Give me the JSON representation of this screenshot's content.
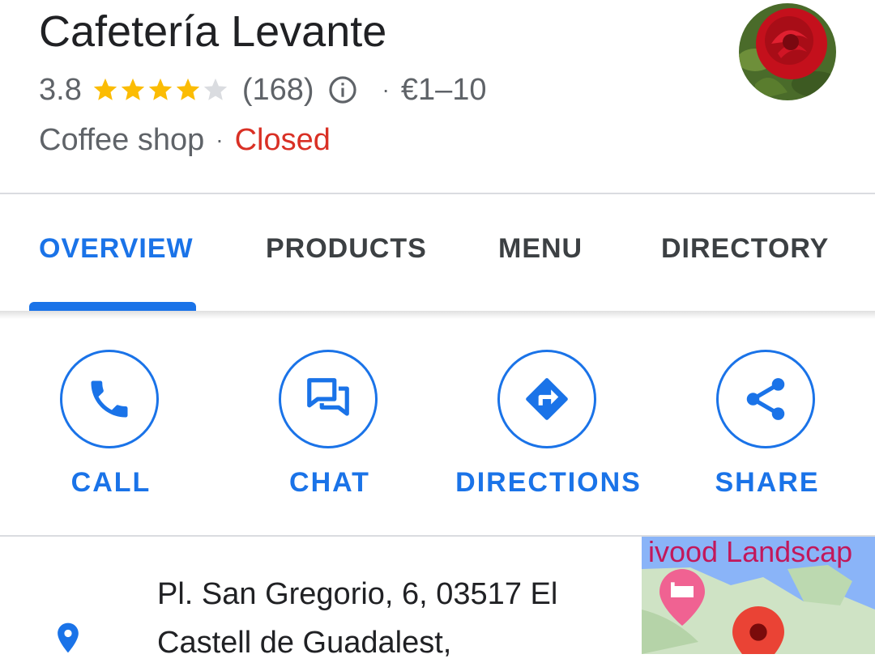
{
  "place": {
    "name": "Cafetería Levante",
    "rating": "3.8",
    "stars_filled": 4,
    "stars_total": 5,
    "review_count": "(168)",
    "price_range": "€1–10",
    "category": "Coffee shop",
    "status": "Closed",
    "separator": "·"
  },
  "tabs": [
    {
      "label": "OVERVIEW",
      "active": true
    },
    {
      "label": "PRODUCTS",
      "active": false
    },
    {
      "label": "MENU",
      "active": false
    },
    {
      "label": "DIRECTORY",
      "active": false
    }
  ],
  "actions": [
    {
      "label": "CALL",
      "icon": "phone-icon"
    },
    {
      "label": "CHAT",
      "icon": "chat-icon"
    },
    {
      "label": "DIRECTIONS",
      "icon": "directions-icon"
    },
    {
      "label": "SHARE",
      "icon": "share-icon"
    }
  ],
  "address": {
    "text": "Pl. San Gregorio, 6, 03517 El Castell de Guadalest,",
    "icon": "location-pin-icon"
  },
  "map": {
    "label": "ivood Landscap"
  },
  "colors": {
    "accent": "#1a73e8",
    "star": "#fbbc04",
    "closed": "#d93025",
    "text_secondary": "#5f6368"
  }
}
